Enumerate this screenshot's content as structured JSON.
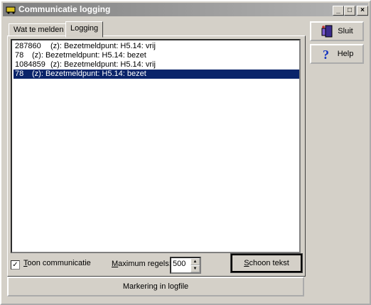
{
  "window": {
    "title": "Communicatie logging"
  },
  "tabs": [
    {
      "label": "Wat te melden"
    },
    {
      "label": "Logging"
    }
  ],
  "log_rows": [
    {
      "num": "287860",
      "msg": "(z): Bezetmeldpunt: H5.14: vrij",
      "selected": false
    },
    {
      "num": "78",
      "msg": "(z): Bezetmeldpunt: H5.14: bezet",
      "selected": false
    },
    {
      "num": "1084859",
      "msg": "(z): Bezetmeldpunt: H5.14: vrij",
      "selected": false
    },
    {
      "num": "78",
      "msg": "(z): Bezetmeldpunt: H5.14: bezet",
      "selected": true
    }
  ],
  "controls": {
    "toon_label_first": "T",
    "toon_label_rest": "oon communicatie",
    "toon_checked": true,
    "max_label_first": "M",
    "max_label_rest": "aximum regels:",
    "max_value": "500",
    "schoon_first": "S",
    "schoon_rest": "choon tekst",
    "markering_label": "Markering in logfile"
  },
  "side_buttons": {
    "sluit_label": "Sluit",
    "help_label": "Help"
  },
  "icons": {
    "app": "app-icon",
    "sluit": "door-exit-icon",
    "help": "question-mark-icon"
  }
}
